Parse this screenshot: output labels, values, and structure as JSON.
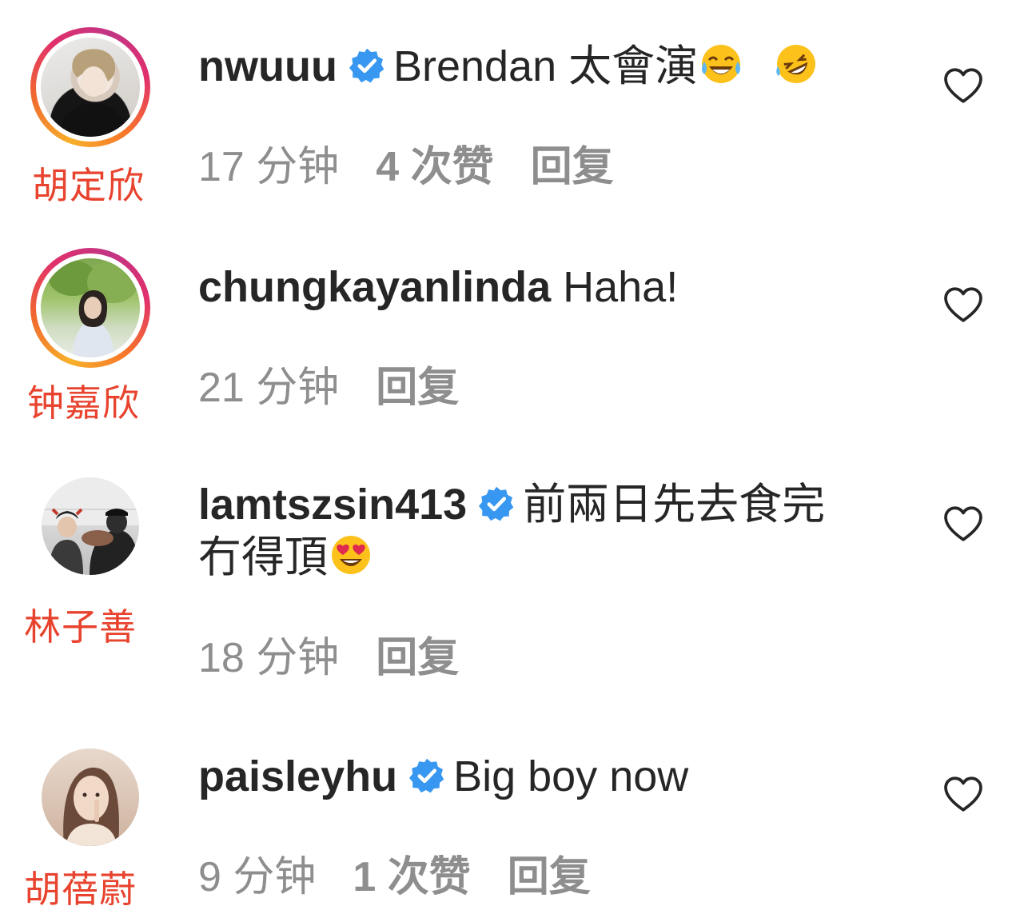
{
  "comments": [
    {
      "username": "nwuuu",
      "realname": "胡定欣",
      "verified": true,
      "text": "Brendan 太會演",
      "emojis": [
        "face-with-tears-of-joy",
        "rolling-on-floor-laughing"
      ],
      "time": "17 分钟",
      "likes": "4 次赞",
      "reply": "回复"
    },
    {
      "username": "chungkayanlinda",
      "realname": "钟嘉欣",
      "verified": false,
      "text": "Haha!",
      "time": "21 分钟",
      "reply": "回复"
    },
    {
      "username": "lamtszsin413",
      "realname": "林子善",
      "verified": true,
      "text": "前兩日先去食完",
      "text_line2": "冇得頂",
      "emojis": [
        "smiling-face-with-heart-eyes"
      ],
      "time": "18 分钟",
      "reply": "回复"
    },
    {
      "username": "paisleyhu",
      "realname": "胡蓓蔚",
      "verified": true,
      "text": "Big boy now",
      "time": "9 分钟",
      "likes": "1 次赞",
      "reply": "回复"
    }
  ],
  "colors": {
    "realname": "#e8432e",
    "meta": "#8e8e8e",
    "verified": "#3897f0",
    "text": "#262626"
  }
}
